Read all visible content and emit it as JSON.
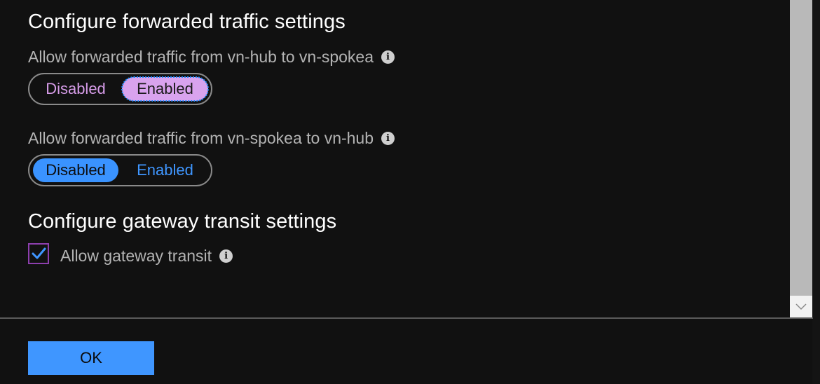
{
  "forwarded_section": {
    "title": "Configure forwarded traffic settings",
    "hub_to_spoke": {
      "label": "Allow forwarded traffic from vn-hub to vn-spokea",
      "options": [
        "Disabled",
        "Enabled"
      ],
      "selected": "Enabled"
    },
    "spoke_to_hub": {
      "label": "Allow forwarded traffic from vn-spokea to vn-hub",
      "options": [
        "Disabled",
        "Enabled"
      ],
      "selected": "Disabled"
    }
  },
  "gateway_section": {
    "title": "Configure gateway transit settings",
    "allow_gateway_transit": {
      "label": "Allow gateway transit",
      "checked": true
    }
  },
  "icons": {
    "info": "info-icon",
    "check": "checkmark-icon",
    "scroll_down": "chevron-down-icon"
  },
  "footer": {
    "ok_label": "OK"
  },
  "colors": {
    "background": "#111111",
    "accent_blue": "#3f96ff",
    "accent_purple": "#d9a3ee",
    "checkbox_border": "#8d3fae"
  }
}
